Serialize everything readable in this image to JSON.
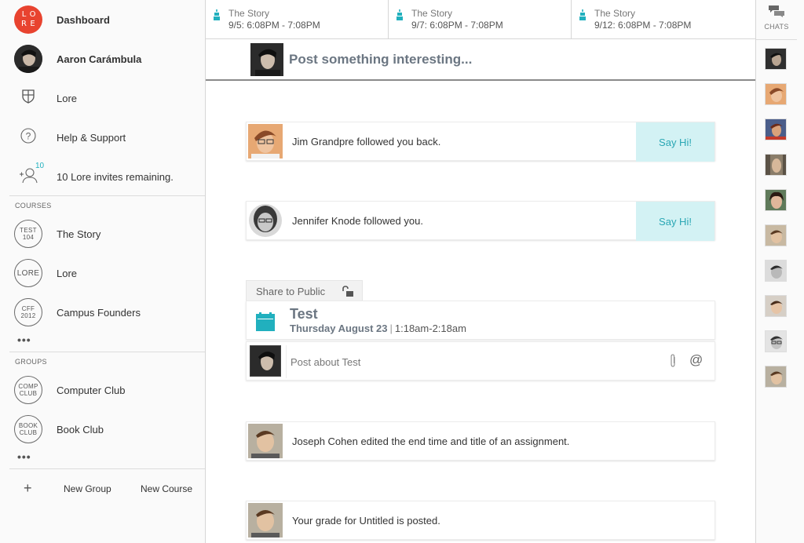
{
  "sidebar": {
    "logo_letters": [
      "L",
      "O",
      "R",
      "E"
    ],
    "nav": [
      {
        "label": "Dashboard",
        "icon": "lore-logo"
      },
      {
        "label": "Aaron Carámbula",
        "icon": "user-avatar"
      },
      {
        "label": "Lore",
        "icon": "shield-icon"
      },
      {
        "label": "Help & Support",
        "icon": "question-icon"
      },
      {
        "label": "10 Lore invites remaining.",
        "icon": "add-user-icon",
        "badge": "10"
      }
    ],
    "courses_title": "COURSES",
    "courses": [
      {
        "label": "The Story",
        "badge": [
          "TEST",
          "104"
        ]
      },
      {
        "label": "Lore",
        "badge": [
          "LORE"
        ]
      },
      {
        "label": "Campus Founders",
        "badge": [
          "CFF",
          "2012"
        ]
      }
    ],
    "groups_title": "GROUPS",
    "groups": [
      {
        "label": "Computer Club",
        "badge": [
          "COMP",
          "CLUB"
        ]
      },
      {
        "label": "Book Club",
        "badge": [
          "BOOK",
          "CLUB"
        ]
      }
    ],
    "more": "•••",
    "new_group": "New Group",
    "new_course": "New Course",
    "plus": "+"
  },
  "schedule": [
    {
      "title": "The Story",
      "time": "9/5: 6:08PM - 7:08PM"
    },
    {
      "title": "The Story",
      "time": "9/7: 6:08PM - 7:08PM"
    },
    {
      "title": "The Story",
      "time": "9/12: 6:08PM - 7:08PM"
    }
  ],
  "composer": {
    "prompt": "Post something interesting..."
  },
  "feed": {
    "notifications": [
      {
        "text": "Jim Grandpre followed you back.",
        "action": "Say Hi!"
      },
      {
        "text": "Jennifer Knode followed you.",
        "action": "Say Hi!"
      }
    ],
    "share_label": "Share to Public",
    "event": {
      "title": "Test",
      "date": "Thursday August 23",
      "separator": "|",
      "time": "1:18am-2:18am"
    },
    "comment_placeholder": "Post about Test",
    "at_symbol": "@",
    "updates": [
      {
        "text": "Joseph Cohen edited the end time and title of an assignment."
      },
      {
        "text": "Your grade for Untitled is posted."
      }
    ]
  },
  "chatbar": {
    "label": "CHATS"
  },
  "colors": {
    "brand_red": "#e8432f",
    "accent_teal": "#21b0be",
    "say_hi_bg": "#d3f2f4",
    "title_slate": "#6b7682"
  }
}
